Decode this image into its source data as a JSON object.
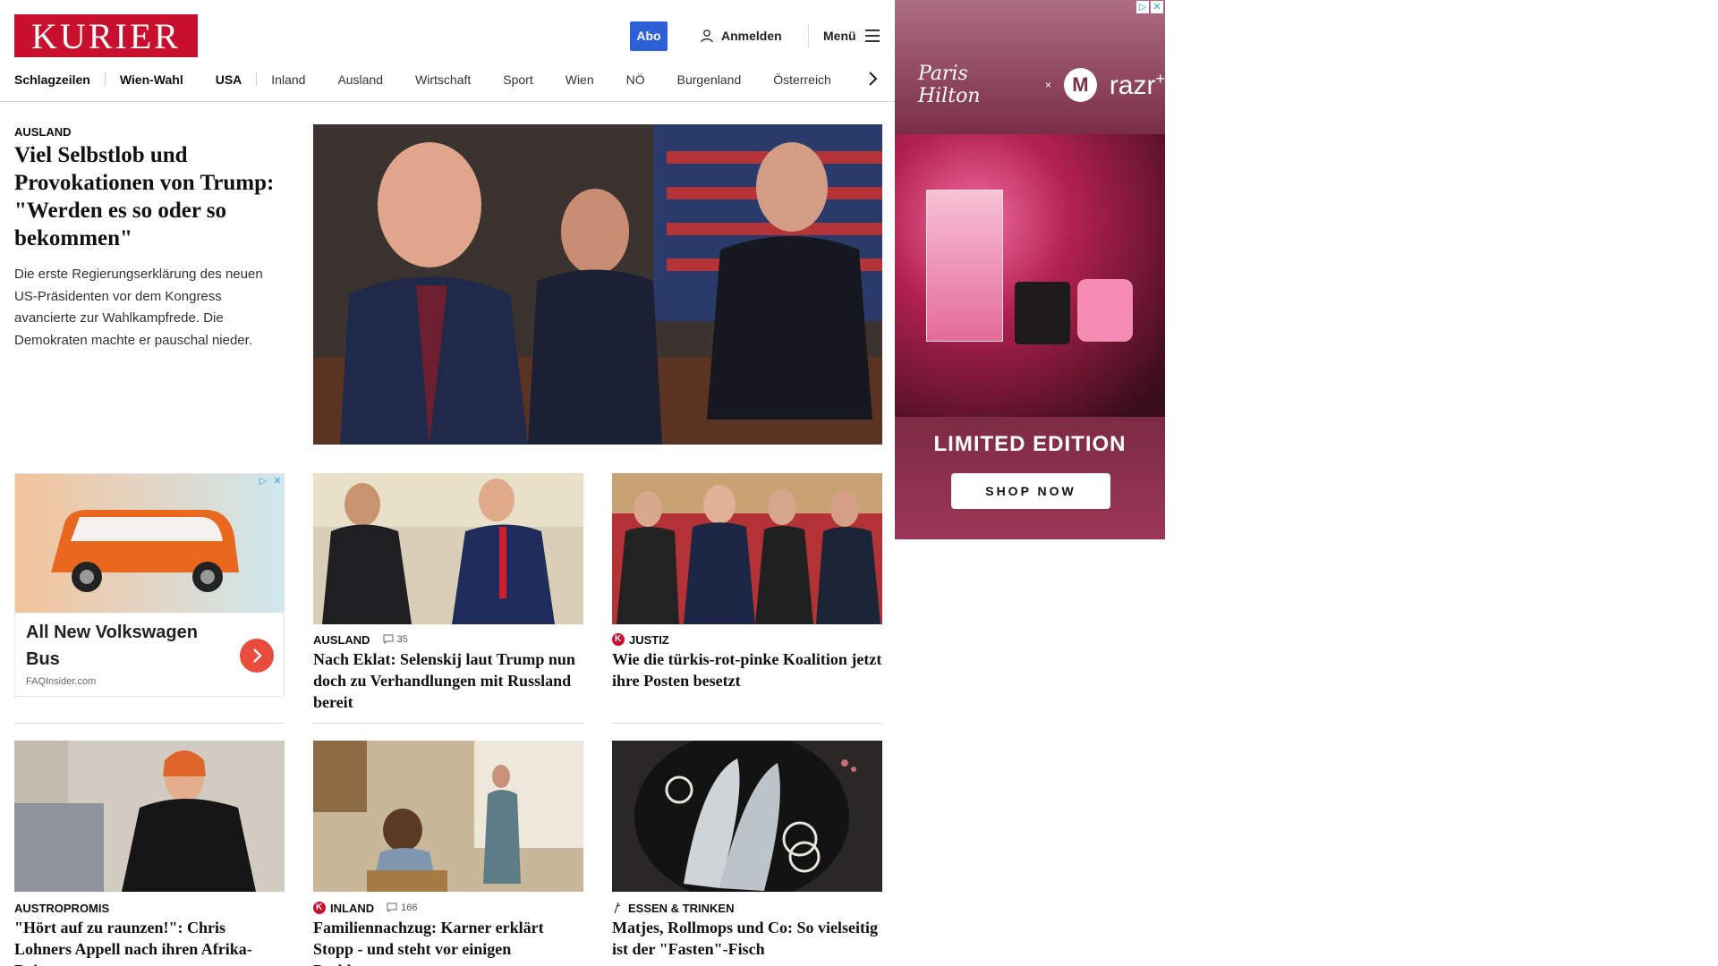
{
  "header": {
    "logo": "KURIER",
    "abo_label": "Abo",
    "login_label": "Anmelden",
    "menu_label": "Menü"
  },
  "nav": {
    "items": [
      "Schlagzeilen",
      "Wien-Wahl",
      "USA",
      "Inland",
      "Ausland",
      "Wirtschaft",
      "Sport",
      "Wien",
      "NÖ",
      "Burgenland",
      "Österreich"
    ]
  },
  "hero": {
    "category": "AUSLAND",
    "title": "Viel Selbstlob und Provokationen von Trump: \"Werden es so oder so bekommen\"",
    "teaser": "Die erste Regierungserklärung des neuen US-Präsidenten vor dem Kongress avancierte zur Wahlkampfrede. Die Demokraten machte er pauschal nieder."
  },
  "ad_vw": {
    "title": "All New Volkswagen Bus",
    "source": "FAQInsider.com"
  },
  "cards": [
    {
      "category": "AUSLAND",
      "comments": "35",
      "title": "Nach Eklat: Selenskij laut Trump nun doch zu Verhandlungen mit Russland bereit"
    },
    {
      "category": "JUSTIZ",
      "title": "Wie die türkis-rot-pinke Koalition jetzt ihre Posten besetzt"
    },
    {
      "category": "AUSTROPROMIS",
      "title": "\"Hört auf zu raunzen!\": Chris Lohners Appell nach ihren Afrika-Reisen"
    },
    {
      "category": "INLAND",
      "comments": "166",
      "title": "Familiennachzug: Karner erklärt Stopp - und steht vor einigen Problemen"
    },
    {
      "category": "ESSEN & TRINKEN",
      "title": "Matjes, Rollmops und Co: So vielseitig ist der \"Fasten\"-Fisch"
    }
  ],
  "side_ad": {
    "brand_left": "Paris Hilton",
    "brand_right": "razr",
    "brand_plus": "+",
    "x_mark": "×",
    "moto_glyph": "M",
    "headline": "LIMITED EDITION",
    "cta": "SHOP NOW"
  },
  "colors": {
    "brand_red": "#c8102e",
    "abo_blue": "#2d5fd6"
  }
}
